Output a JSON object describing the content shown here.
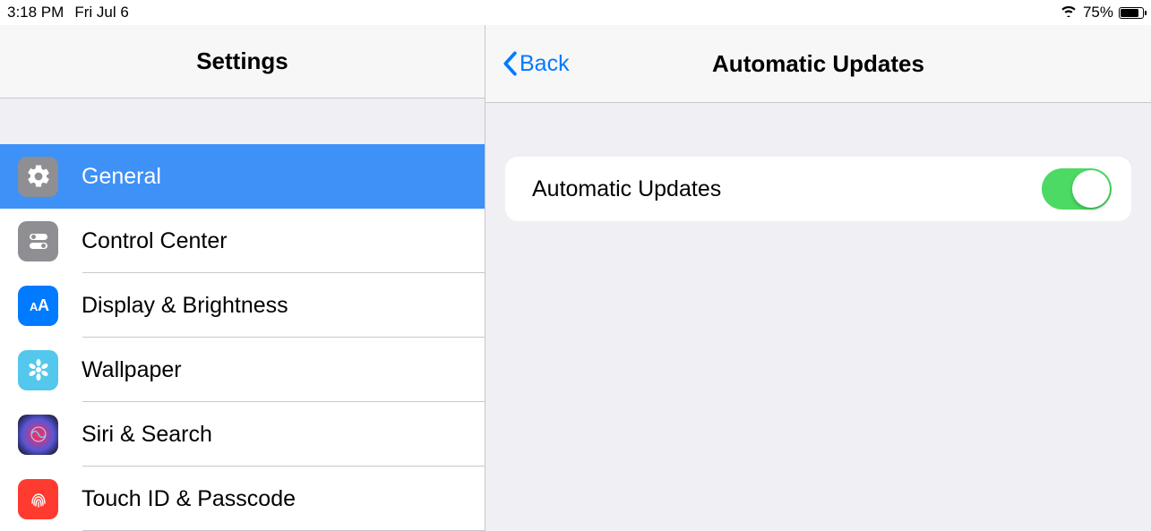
{
  "status": {
    "time": "3:18 PM",
    "date": "Fri Jul 6",
    "battery_percent": "75%"
  },
  "sidebar": {
    "title": "Settings",
    "items": [
      {
        "label": "General"
      },
      {
        "label": "Control Center"
      },
      {
        "label": "Display & Brightness"
      },
      {
        "label": "Wallpaper"
      },
      {
        "label": "Siri & Search"
      },
      {
        "label": "Touch ID & Passcode"
      }
    ]
  },
  "detail": {
    "back_label": "Back",
    "title": "Automatic Updates",
    "row_label": "Automatic Updates",
    "toggle_on": true
  }
}
